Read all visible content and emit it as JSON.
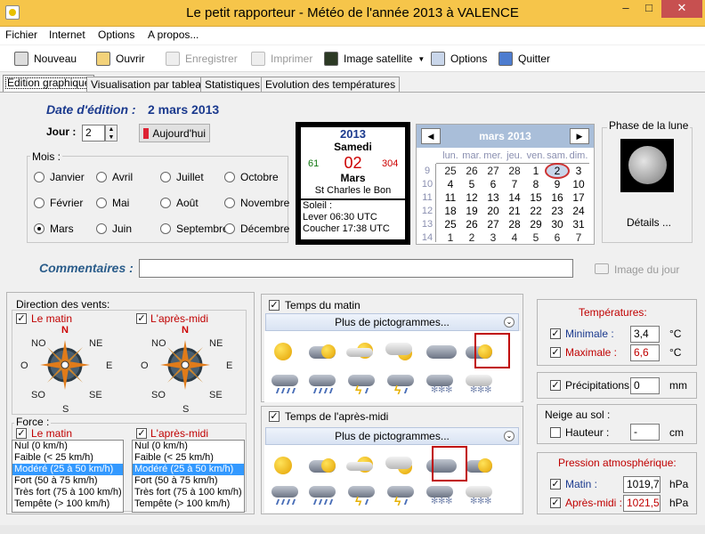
{
  "window": {
    "title": "Le petit rapporteur - Météo de l'année 2013 à VALENCE",
    "minimize": "–",
    "maximize": "□",
    "close": "✕"
  },
  "menu": [
    "Fichier",
    "Internet",
    "Options",
    "A propos..."
  ],
  "toolbar": {
    "new": "Nouveau",
    "open": "Ouvrir",
    "save": "Enregistrer",
    "print": "Imprimer",
    "satellite": "Image satellite",
    "options": "Options",
    "quit": "Quitter"
  },
  "tabs": [
    "Edition graphique",
    "Visualisation par tableau",
    "Statistiques",
    "Evolution des températures"
  ],
  "edit": {
    "date_label": "Date d'édition :",
    "date_value": "2 mars 2013",
    "day_label": "Jour :",
    "day_value": "2",
    "today_button": "Aujourd'hui"
  },
  "months": {
    "legend": "Mois :",
    "items": [
      "Janvier",
      "Avril",
      "Juillet",
      "Octobre",
      "Février",
      "Mai",
      "Août",
      "Novembre",
      "Mars",
      "Juin",
      "Septembre",
      "Décembre"
    ],
    "selected": "Mars"
  },
  "daycard": {
    "year": "2013",
    "weekday": "Samedi",
    "day_of_year": "61",
    "day": "02",
    "days_left": "304",
    "month": "Mars",
    "saint": "St Charles le Bon",
    "sun_label": "Soleil :",
    "sunrise": "Lever 06:30 UTC",
    "sunset": "Coucher 17:38 UTC"
  },
  "calendar": {
    "title": "mars 2013",
    "prev": "◀",
    "next": "▶",
    "headers": [
      "lun.",
      "mar.",
      "mer.",
      "jeu.",
      "ven.",
      "sam.",
      "dim."
    ],
    "weeks": [
      "9",
      "10",
      "11",
      "12",
      "13",
      "14"
    ],
    "rows": [
      [
        "25",
        "26",
        "27",
        "28",
        "1",
        "2",
        "3"
      ],
      [
        "4",
        "5",
        "6",
        "7",
        "8",
        "9",
        "10"
      ],
      [
        "11",
        "12",
        "13",
        "14",
        "15",
        "16",
        "17"
      ],
      [
        "18",
        "19",
        "20",
        "21",
        "22",
        "23",
        "24"
      ],
      [
        "25",
        "26",
        "27",
        "28",
        "29",
        "30",
        "31"
      ],
      [
        "1",
        "2",
        "3",
        "4",
        "5",
        "6",
        "7"
      ]
    ]
  },
  "moon": {
    "title": "Phase de la lune",
    "details": "Détails ..."
  },
  "comments": {
    "label": "Commentaires :",
    "value": "",
    "photo": "Image du jour"
  },
  "wind": {
    "title": "Direction des vents:",
    "morning": "Le matin",
    "afternoon": "L'après-midi",
    "dirs": [
      "N",
      "NO",
      "NE",
      "O",
      "E",
      "SO",
      "SE",
      "S"
    ]
  },
  "force": {
    "title": "Force :",
    "morning": "Le matin",
    "afternoon": "L'après-midi",
    "items": [
      "Nul (0 km/h)",
      "Faible (< 25 km/h)",
      "Modéré (25 à 50 km/h)",
      "Fort (50 à 75 km/h)",
      "Très fort (75 à 100 km/h)",
      "Tempête (> 100 km/h)"
    ],
    "selected_morning": "Modéré (25 à 50 km/h)",
    "selected_afternoon": "Modéré (25 à 50 km/h)"
  },
  "weather": {
    "morning_title": "Temps du matin",
    "afternoon_title": "Temps de l'après-midi",
    "more": "Plus de pictogrammes...",
    "morning_selected": "cloudy-dark",
    "afternoon_selected": "cloud-sun"
  },
  "temps": {
    "title": "Températures:",
    "min_label": "Minimale :",
    "min_value": "3,4",
    "max_label": "Maximale :",
    "max_value": "6,6",
    "unit": "°C"
  },
  "precip": {
    "label": "Précipitations :",
    "value": "0",
    "unit": "mm"
  },
  "snow": {
    "title": "Neige au sol :",
    "label": "Hauteur :",
    "value": "-",
    "unit": "cm"
  },
  "pressure": {
    "title": "Pression atmosphérique:",
    "morning_label": "Matin :",
    "morning_value": "1019,7",
    "afternoon_label": "Après-midi :",
    "afternoon_value": "1021,5",
    "unit": "hPa"
  },
  "colors": {
    "accent": "#1b3a8e",
    "title_bar": "#f6c54a",
    "red_label": "#c00000",
    "selection": "#3399ff"
  }
}
